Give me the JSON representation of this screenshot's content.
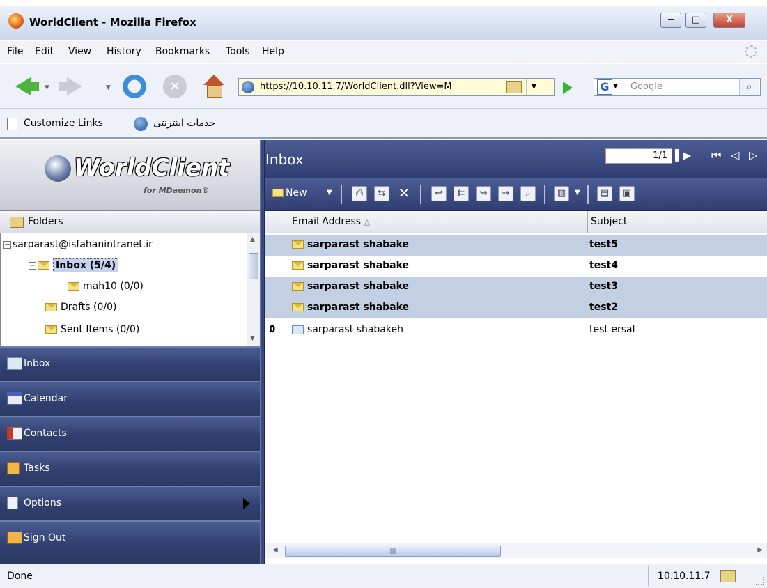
{
  "window": {
    "title": "WorldClient - Mozilla Firefox",
    "minimize": "─",
    "maximize": "□",
    "close": "X"
  },
  "menu": [
    "File",
    "Edit",
    "View",
    "History",
    "Bookmarks",
    "Tools",
    "Help"
  ],
  "nav": {
    "url": "https://10.10.11.7/WorldClient.dll?View=M",
    "search_placeholder": "Google",
    "search_engine_glyph": "G"
  },
  "links": {
    "customize": "Customize Links",
    "internet_services": "خدمات اینترنتی"
  },
  "sidebar": {
    "logo_text": "WorldClient",
    "logo_sub": "for MDaemon®",
    "folders_label": "Folders",
    "tree": [
      {
        "label": "sarparast@isfahanintranet.ir"
      },
      {
        "label": "Inbox (5/4)"
      },
      {
        "label": "mah10 (0/0)"
      },
      {
        "label": "Drafts (0/0)"
      },
      {
        "label": "Sent Items (0/0)"
      }
    ],
    "nav_items": [
      {
        "label": "Inbox",
        "icon": "inbox-icon"
      },
      {
        "label": "Calendar",
        "icon": "calendar-icon"
      },
      {
        "label": "Contacts",
        "icon": "contacts-icon"
      },
      {
        "label": "Tasks",
        "icon": "tasks-icon"
      },
      {
        "label": "Options",
        "icon": "options-icon"
      },
      {
        "label": "Sign Out",
        "icon": "sign-out-icon"
      }
    ]
  },
  "main": {
    "title": "Inbox",
    "page_indicator": "1/1",
    "new_label": "New",
    "columns": {
      "email": "Email Address",
      "subject": "Subject"
    },
    "messages": [
      {
        "from": "sarparast shabake",
        "subject": "test5",
        "unread": true,
        "selected": true,
        "attachment": false
      },
      {
        "from": "sarparast shabake",
        "subject": "test4",
        "unread": true,
        "selected": false,
        "attachment": false
      },
      {
        "from": "sarparast shabake",
        "subject": "test3",
        "unread": true,
        "selected": true,
        "attachment": false
      },
      {
        "from": "sarparast shabake",
        "subject": "test2",
        "unread": true,
        "selected": true,
        "attachment": false
      },
      {
        "from": "sarparast shabakeh",
        "subject": "test ersal",
        "unread": false,
        "selected": false,
        "attachment": true
      }
    ]
  },
  "status": {
    "left": "Done",
    "host": "10.10.11.7"
  },
  "colors": {
    "nav_blue": "#31406f",
    "selected_row": "#c3cfe3"
  }
}
